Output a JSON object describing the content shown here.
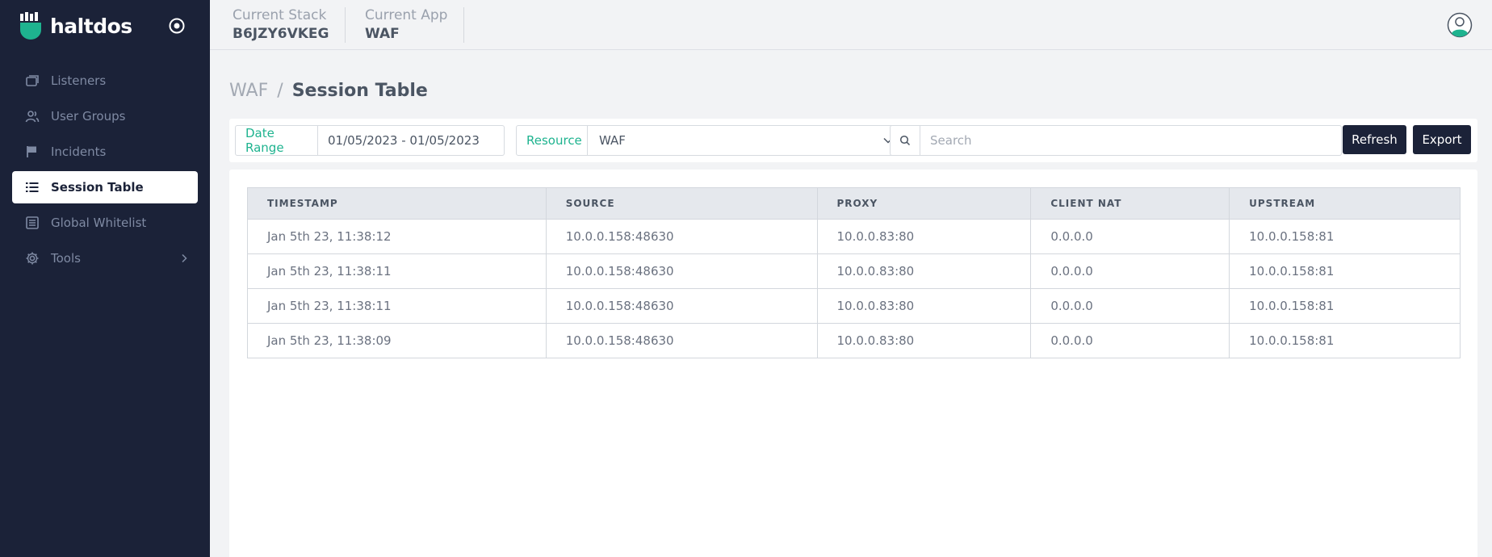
{
  "app": {
    "brand_name": "haltdos"
  },
  "sidebar": {
    "items": [
      {
        "label": "Listeners",
        "icon": "windows-icon"
      },
      {
        "label": "User Groups",
        "icon": "users-icon"
      },
      {
        "label": "Incidents",
        "icon": "flag-icon"
      },
      {
        "label": "Session Table",
        "icon": "list-icon",
        "active": true
      },
      {
        "label": "Global Whitelist",
        "icon": "list-box-icon"
      },
      {
        "label": "Tools",
        "icon": "gear-icon",
        "has_submenu": true
      }
    ]
  },
  "header": {
    "stack_label": "Current Stack",
    "stack_value": "B6JZY6VKEG",
    "app_label": "Current App",
    "app_value": "WAF"
  },
  "breadcrumb": {
    "parent": "WAF",
    "separator": "/",
    "current": "Session Table"
  },
  "filters": {
    "date_range_label": "Date Range",
    "date_range_value": "01/05/2023 - 01/05/2023",
    "resource_label": "Resource",
    "resource_value": "WAF",
    "search_placeholder": "Search",
    "refresh_label": "Refresh",
    "export_label": "Export"
  },
  "table": {
    "columns": [
      "TIMESTAMP",
      "SOURCE",
      "PROXY",
      "CLIENT NAT",
      "UPSTREAM"
    ],
    "rows": [
      [
        "Jan 5th 23, 11:38:12",
        "10.0.0.158:48630",
        "10.0.0.83:80",
        "0.0.0.0",
        "10.0.0.158:81"
      ],
      [
        "Jan 5th 23, 11:38:11",
        "10.0.0.158:48630",
        "10.0.0.83:80",
        "0.0.0.0",
        "10.0.0.158:81"
      ],
      [
        "Jan 5th 23, 11:38:11",
        "10.0.0.158:48630",
        "10.0.0.83:80",
        "0.0.0.0",
        "10.0.0.158:81"
      ],
      [
        "Jan 5th 23, 11:38:09",
        "10.0.0.158:48630",
        "10.0.0.83:80",
        "0.0.0.0",
        "10.0.0.158:81"
      ]
    ]
  },
  "colors": {
    "sidebar_bg": "#1b2238",
    "accent": "#1eb38f",
    "button_bg": "#1b2238"
  }
}
